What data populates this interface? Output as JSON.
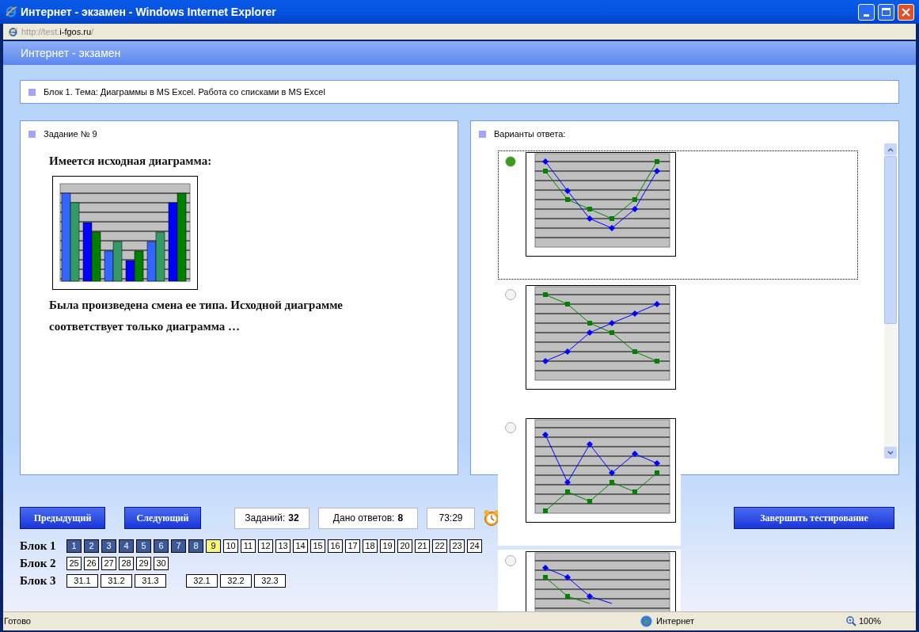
{
  "window": {
    "title": "Интернет - экзамен - Windows Internet Explorer"
  },
  "address": {
    "scheme": "http://test.",
    "domain": "i-fgos.ru",
    "path": "/"
  },
  "page_header": "Интернет - экзамен",
  "topic": "Блок 1. Тема: Диаграммы в MS Excel. Работа со списками в MS Excel",
  "task": {
    "heading": "Задание № 9",
    "intro": "Имеется исходная диаграмма:",
    "text": "Была произведена смена ее типа. Исходной диаграмме соответствует только диаграмма …"
  },
  "answers": {
    "heading": "Варианты ответа:",
    "options": [
      {
        "selected": true,
        "focused": true
      },
      {
        "selected": false,
        "focused": false
      },
      {
        "selected": false,
        "focused": false
      },
      {
        "selected": false,
        "focused": false
      }
    ]
  },
  "nav": {
    "prev": "Предыдущий",
    "next": "Следующий",
    "tasks_label": "Заданий:",
    "tasks_value": "32",
    "answered_label": "Дано ответов:",
    "answered_value": "8",
    "timer": "73:29",
    "finish": "Завершить тестирование"
  },
  "blocks": [
    {
      "label": "Блок 1",
      "groups": [
        [
          {
            "label": "1",
            "answered": true,
            "selected": false
          },
          {
            "label": "2",
            "answered": true,
            "selected": false
          },
          {
            "label": "3",
            "answered": true,
            "selected": false
          },
          {
            "label": "4",
            "answered": true,
            "selected": false
          },
          {
            "label": "5",
            "answered": true,
            "selected": false
          },
          {
            "label": "6",
            "answered": true,
            "selected": false
          },
          {
            "label": "7",
            "answered": true,
            "selected": false
          },
          {
            "label": "8",
            "answered": true,
            "selected": false
          },
          {
            "label": "9",
            "answered": false,
            "selected": true
          },
          {
            "label": "10",
            "answered": false,
            "selected": false
          },
          {
            "label": "11",
            "answered": false,
            "selected": false
          },
          {
            "label": "12",
            "answered": false,
            "selected": false
          },
          {
            "label": "13",
            "answered": false,
            "selected": false
          },
          {
            "label": "14",
            "answered": false,
            "selected": false
          },
          {
            "label": "15",
            "answered": false,
            "selected": false
          },
          {
            "label": "16",
            "answered": false,
            "selected": false
          },
          {
            "label": "17",
            "answered": false,
            "selected": false
          },
          {
            "label": "18",
            "answered": false,
            "selected": false
          },
          {
            "label": "19",
            "answered": false,
            "selected": false
          },
          {
            "label": "20",
            "answered": false,
            "selected": false
          },
          {
            "label": "21",
            "answered": false,
            "selected": false
          },
          {
            "label": "22",
            "answered": false,
            "selected": false
          },
          {
            "label": "23",
            "answered": false,
            "selected": false
          },
          {
            "label": "24",
            "answered": false,
            "selected": false
          }
        ]
      ]
    },
    {
      "label": "Блок 2",
      "groups": [
        [
          {
            "label": "25",
            "answered": false,
            "selected": false
          },
          {
            "label": "26",
            "answered": false,
            "selected": false
          },
          {
            "label": "27",
            "answered": false,
            "selected": false
          },
          {
            "label": "28",
            "answered": false,
            "selected": false
          },
          {
            "label": "29",
            "answered": false,
            "selected": false
          },
          {
            "label": "30",
            "answered": false,
            "selected": false
          }
        ]
      ]
    },
    {
      "label": "Блок 3",
      "groups": [
        [
          {
            "label": "31.1",
            "answered": false,
            "selected": false
          },
          {
            "label": "31.2",
            "answered": false,
            "selected": false
          },
          {
            "label": "31.3",
            "answered": false,
            "selected": false
          }
        ],
        [
          {
            "label": "32.1",
            "answered": false,
            "selected": false
          },
          {
            "label": "32.2",
            "answered": false,
            "selected": false
          },
          {
            "label": "32.3",
            "answered": false,
            "selected": false
          }
        ]
      ]
    }
  ],
  "status_bar": {
    "text": "Готово",
    "zone": "Интернет",
    "zoom": "100%"
  }
}
